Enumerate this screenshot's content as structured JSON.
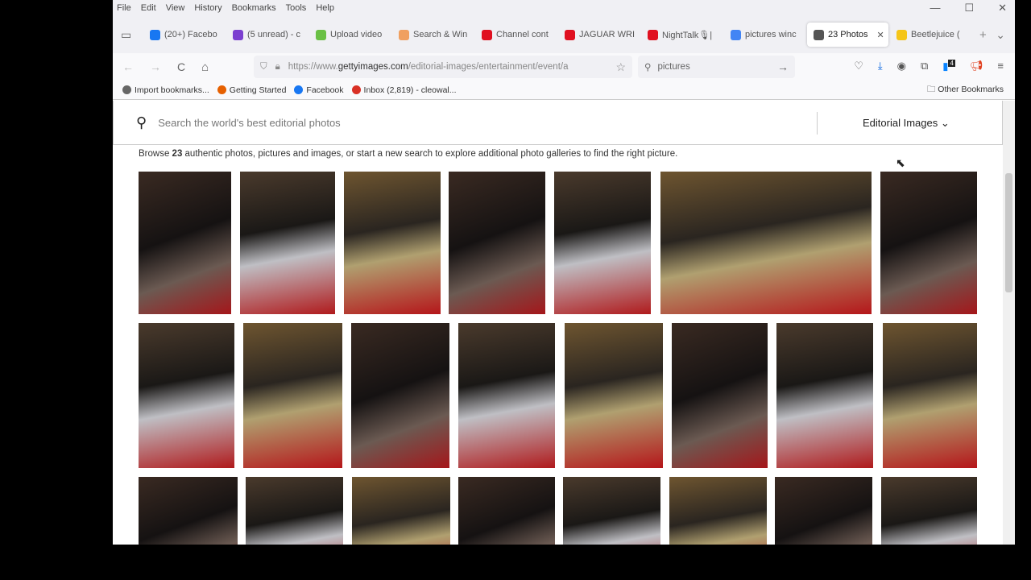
{
  "menu": [
    "File",
    "Edit",
    "View",
    "History",
    "Bookmarks",
    "Tools",
    "Help"
  ],
  "window_controls": {
    "minimize": "—",
    "maximize": "☐",
    "close": "✕"
  },
  "tabs": [
    {
      "label": "(20+) Facebo",
      "color": "#1877f2"
    },
    {
      "label": "(5 unread) - c",
      "color": "#7b3fd0"
    },
    {
      "label": "Upload video",
      "color": "#6ac045"
    },
    {
      "label": "Search & Win",
      "color": "#f0a060"
    },
    {
      "label": "Channel cont",
      "color": "#e01020"
    },
    {
      "label": "JAGUAR WRI",
      "color": "#e01020"
    },
    {
      "label": "NightTalk🎙|",
      "color": "#e01020"
    },
    {
      "label": "pictures winc",
      "color": "#4285f4"
    },
    {
      "label": "23 Photos",
      "color": "#555555",
      "active": true
    },
    {
      "label": "Beetlejuice (",
      "color": "#f5c518"
    }
  ],
  "tab_close": "✕",
  "new_tab": "+",
  "tab_list": "⌄",
  "nav": {
    "back": "←",
    "forward": "→",
    "reload": "C",
    "home": "⌂"
  },
  "url": {
    "prefix": "https://www.",
    "domain": "gettyimages.com",
    "path": "/editorial-images/entertainment/event/a"
  },
  "search": {
    "value": "pictures",
    "go": "→"
  },
  "toolbar_badge": "4",
  "bookmarks": [
    {
      "label": "Import bookmarks...",
      "color": "#666666"
    },
    {
      "label": "Getting Started",
      "color": "#e66000"
    },
    {
      "label": "Facebook",
      "color": "#1877f2"
    },
    {
      "label": "Inbox (2,819) - cleowal...",
      "color": "#d93025"
    }
  ],
  "other_bookmarks": "Other Bookmarks",
  "page": {
    "search_placeholder": "Search the world's best editorial photos",
    "filter": "Editorial Images",
    "filter_chevron": "⌄",
    "browse_pre": "Browse ",
    "browse_count": "23",
    "browse_post": " authentic photos, pictures and images, or start a new search to explore additional photo galleries to find the right picture."
  }
}
